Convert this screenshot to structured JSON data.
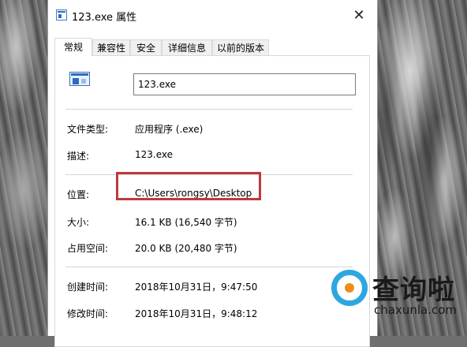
{
  "window": {
    "title": "123.exe 属性",
    "close_glyph": "✕"
  },
  "tabs": [
    {
      "label": "常规",
      "active": true
    },
    {
      "label": "兼容性",
      "active": false
    },
    {
      "label": "安全",
      "active": false
    },
    {
      "label": "详细信息",
      "active": false
    },
    {
      "label": "以前的版本",
      "active": false
    }
  ],
  "general": {
    "file_name": "123.exe",
    "rows": [
      {
        "label": "文件类型:",
        "value": "应用程序 (.exe)"
      },
      {
        "label": "描述:",
        "value": "123.exe"
      },
      {
        "label": "位置:",
        "value": "C:\\Users\\rongsy\\Desktop"
      },
      {
        "label": "大小:",
        "value": "16.1 KB (16,540 字节)"
      },
      {
        "label": "占用空间:",
        "value": "20.0 KB (20,480 字节)"
      },
      {
        "label": "创建时间:",
        "value": "2018年10月31日，9:47:50"
      },
      {
        "label": "修改时间:",
        "value": "2018年10月31日，9:48:12"
      }
    ]
  },
  "watermark": {
    "text": "查询啦",
    "domain": "chaxunla.com"
  },
  "colors": {
    "highlight": "#c0393b",
    "watermark_blue": "#2ea7e0",
    "watermark_orange": "#f08c1e"
  },
  "icons": {
    "title_icon": "application-icon",
    "file_icon": "exe-file-icon",
    "close": "close-icon"
  }
}
